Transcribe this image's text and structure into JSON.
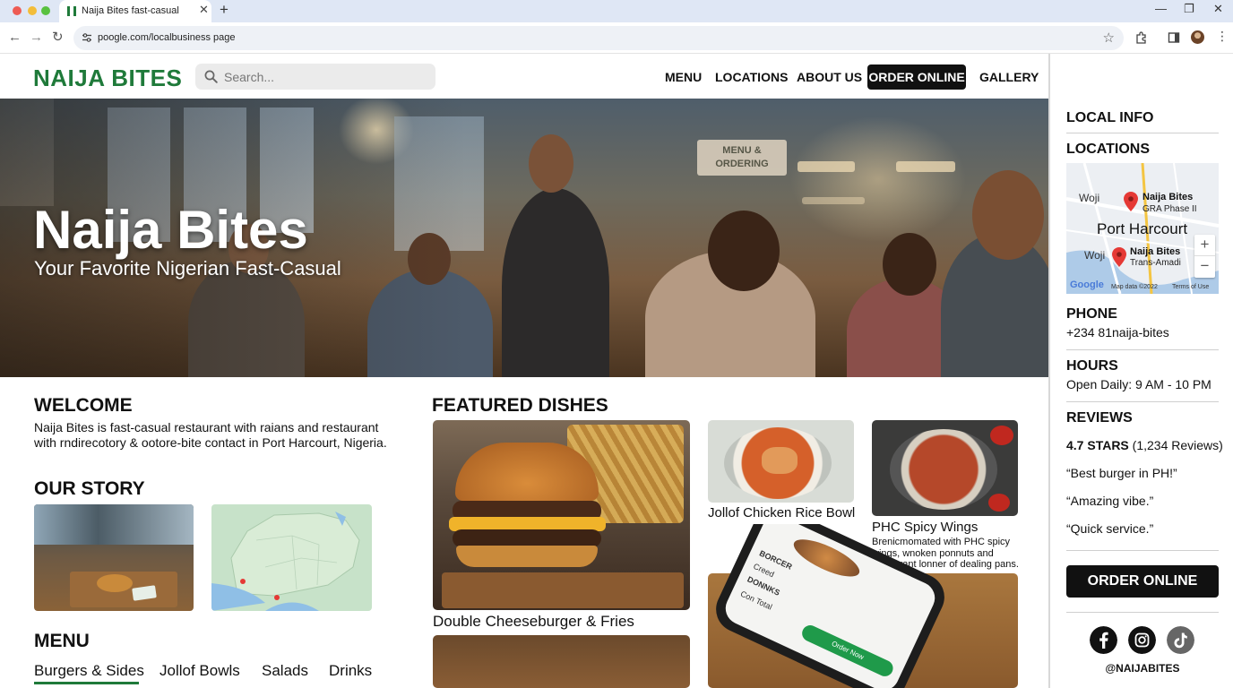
{
  "browser": {
    "tab_title": "Naija Bites fast-casual",
    "url": "poogle.com/localbusiness page",
    "icons": [
      "back-icon",
      "forward-icon",
      "reload-icon",
      "site-info-icon",
      "bookmark-star-icon",
      "extensions-icon",
      "side-panel-icon",
      "profile-avatar",
      "menu-kebab-icon"
    ]
  },
  "header": {
    "logo": "NAIJA BITES",
    "search_placeholder": "Search...",
    "nav": [
      "MENU",
      "LOCATIONS",
      "ABOUT US",
      "ORDER ONLINE",
      "GALLERY"
    ]
  },
  "hero": {
    "title": "Naija Bites",
    "subtitle": "Your Favorite Nigerian Fast-Casual",
    "sign": "MENU & ORDERING"
  },
  "welcome": {
    "heading": "WELCOME",
    "text": "Naija Bites is fast-casual restaurant with raians and restaurant with rndirecotory & ootore-bite contact in Port Harcourt, Nigeria."
  },
  "story": {
    "heading": "OUR STORY"
  },
  "menu": {
    "heading": "MENU",
    "tabs": [
      "Burgers & Sides",
      "Jollof Bowls",
      "Salads",
      "Drinks"
    ],
    "active_tab": "Burgers & Sides"
  },
  "featured": {
    "heading": "FEATURED DISHES",
    "dishes": [
      {
        "name": "Double Cheeseburger & Fries"
      },
      {
        "name": "Jollof Chicken Rice Bowl"
      },
      {
        "name": "PHC Spicy Wings",
        "desc": "Brenicmomated with PHC spicy wings, wnoken ponnuts and restaurant lonner of dealing pans."
      }
    ],
    "phone_screen": {
      "rows": [
        "BORCER",
        "Creed",
        "DONNKS",
        "Con Total"
      ],
      "button": "Order Now"
    }
  },
  "sidebar": {
    "local_info": "LOCAL INFO",
    "locations_heading": "LOCATIONS",
    "map": {
      "city": "Port Harcourt",
      "area_1": "Woji",
      "area_2": "Woji",
      "pin_1_name": "Naija Bites",
      "pin_1_sub": "GRA Phase II",
      "pin_2_name": "Naija Bites",
      "pin_2_sub": "Trans-Amadi",
      "google": "Google",
      "attribution": "Map data ©2022",
      "terms": "Terms of Use",
      "zoom_in": "+",
      "zoom_out": "−"
    },
    "phone_heading": "PHONE",
    "phone": "+234 81naija-bites",
    "hours_heading": "HOURS",
    "hours": "Open Daily: 9 AM - 10 PM",
    "reviews_heading": "REVIEWS",
    "rating": "4.7 STARS",
    "rating_count": "(1,234 Reviews)",
    "reviews": [
      "“Best burger in PH!”",
      "“Amazing vibe.”",
      "“Quick service.”"
    ],
    "cta": "ORDER ONLINE",
    "social_icons": [
      "facebook-icon",
      "instagram-icon",
      "tiktok-icon"
    ],
    "handle": "@NAIJABITES"
  },
  "colors": {
    "brand_green": "#1f7a3a",
    "cta_black": "#111111",
    "map_pin": "#e53935"
  }
}
